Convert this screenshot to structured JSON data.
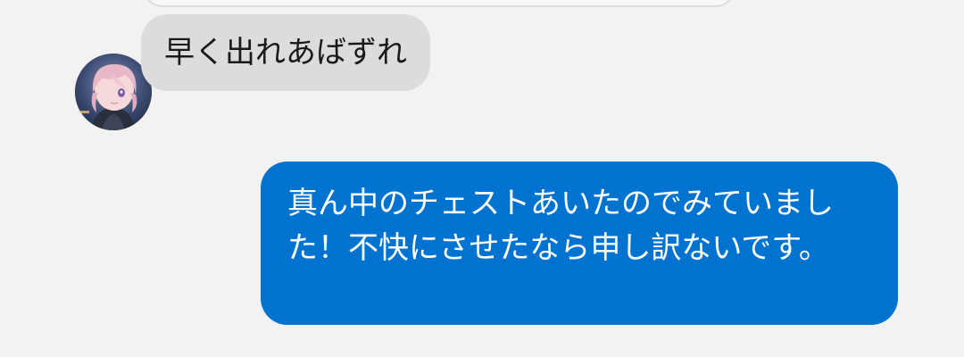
{
  "conversation": {
    "messages": [
      {
        "direction": "incoming",
        "text": "早く出れあばずれ"
      },
      {
        "direction": "outgoing",
        "text": "真ん中のチェストあいたのでみていました！不快にさせたなら申し訳ないです。"
      }
    ]
  },
  "colors": {
    "background": "#f2f2f2",
    "incoming_bubble": "#dcdcdc",
    "outgoing_bubble": "#0072cf"
  },
  "icons": {
    "contact_avatar": "avatar"
  }
}
